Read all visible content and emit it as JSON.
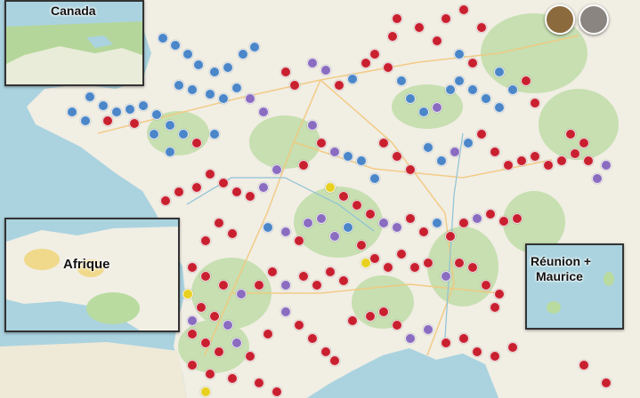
{
  "insets": {
    "canada": {
      "title": "Canada"
    },
    "afrique": {
      "title": "Afrique"
    },
    "reunion": {
      "title_line1": "Réunion +",
      "title_line2": "Maurice"
    }
  },
  "marker_colors": {
    "red": "#c9202f",
    "blue": "#4a86c8",
    "purple": "#8a6cc0",
    "yellow": "#e8d020"
  },
  "layer_thumbnails": [
    {
      "name": "map-style-thumbnail-brown",
      "color": "#8b6b3d"
    },
    {
      "name": "map-style-thumbnail-gray",
      "color": "#8a8580"
    }
  ]
}
